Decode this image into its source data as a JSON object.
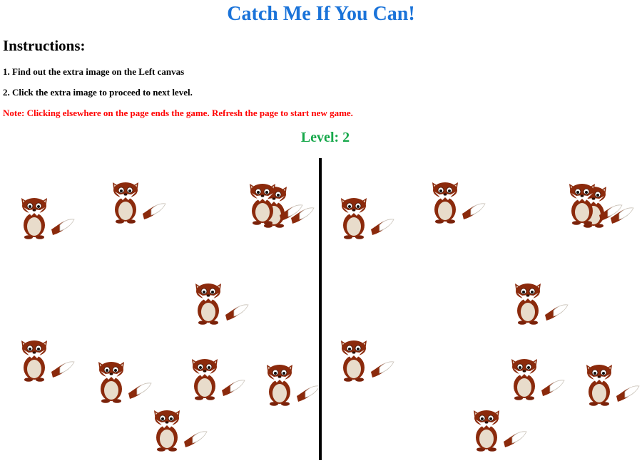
{
  "title": "Catch Me If You Can!",
  "instructions": {
    "heading": "Instructions:",
    "steps": [
      "1. Find out the extra image on the Left canvas",
      "2. Click the extra image to proceed to next level."
    ],
    "note": "Note: Clicking elsewhere on the page ends the game. Refresh the page to start new game."
  },
  "level_text": "Level: 2",
  "sprite_icon": "fox-icon",
  "colors": {
    "title": "#1a73d9",
    "note": "#ff0000",
    "level": "#17a84b",
    "fox_fur": "#8b2a0c",
    "fox_belly": "#e8dccb",
    "divider": "#000000"
  }
}
